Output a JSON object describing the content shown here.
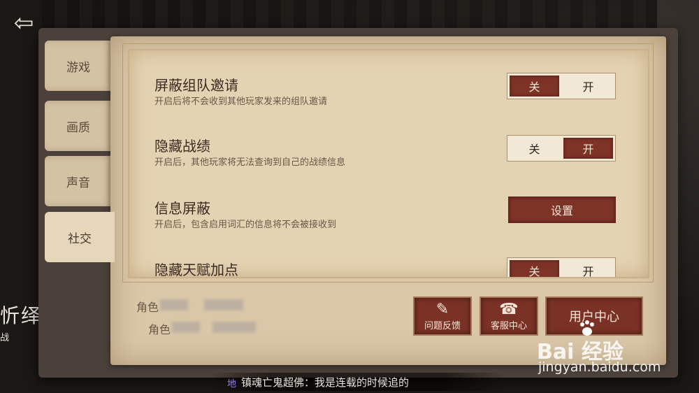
{
  "left_panel": {
    "title": "忻绎",
    "subtitle": "战"
  },
  "tabs": [
    {
      "label": "游戏",
      "active": false
    },
    {
      "label": "画质",
      "active": false
    },
    {
      "label": "声音",
      "active": false
    },
    {
      "label": "社交",
      "active": true
    }
  ],
  "settings": [
    {
      "title": "屏蔽组队邀请",
      "desc": "开启后将不会收到其他玩家发来的组队邀请",
      "control": "toggle",
      "off_label": "关",
      "on_label": "开",
      "value": "关"
    },
    {
      "title": "隐藏战绩",
      "desc": "开启后，其他玩家将无法查询到自己的战绩信息",
      "control": "toggle",
      "off_label": "关",
      "on_label": "开",
      "value": "开"
    },
    {
      "title": "信息屏蔽",
      "desc": "开启后，包含启用词汇的信息将不会被接收到",
      "control": "button",
      "button_label": "设置"
    },
    {
      "title": "隐藏天赋加点",
      "desc": "",
      "control": "toggle",
      "off_label": "关",
      "on_label": "开",
      "value": "关"
    }
  ],
  "account": {
    "role_label_1": "角色",
    "role_label_2": "角色"
  },
  "bottom_buttons": {
    "feedback_label": "问题反馈",
    "feedback_icon": "pen-icon",
    "service_label": "客服中心",
    "service_icon": "telephone-icon",
    "user_center_label": "用户中心"
  },
  "chat": {
    "tag": "地",
    "message": "镇魂亡鬼超佛：我是连载的时候追的"
  },
  "watermark": {
    "logo_text": "Bai  经验",
    "url": "jingyan.baidu.com"
  },
  "colors": {
    "accent_red": "#7e3327",
    "paper": "#e4d3b3"
  }
}
